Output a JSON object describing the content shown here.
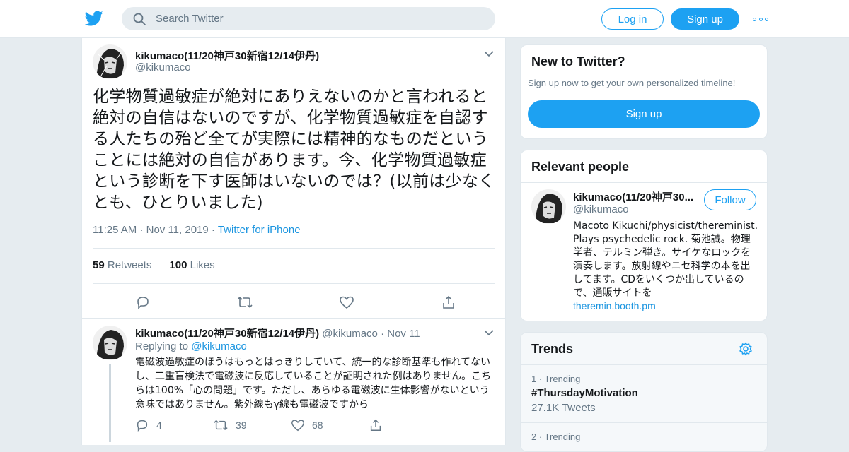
{
  "topbar": {
    "search_placeholder": "Search Twitter",
    "login_label": "Log in",
    "signup_label": "Sign up"
  },
  "tweet": {
    "display_name": "kikumaco(11/20神戸30新宿12/14伊丹)",
    "handle": "@kikumaco",
    "text": "化学物質過敏症が絶対にありえないのかと言われると絶対の自信はないのですが、化学物質過敏症を自認する人たちの殆ど全てが実際には精神的なものだということには絶対の自信があります。今、化学物質過敏症という診断を下す医師はいないのでは？(以前は少なくとも、ひとりいました)",
    "time": "11:25 AM",
    "date": "Nov 11, 2019",
    "source": "Twitter for iPhone",
    "retweets_count": "59",
    "retweets_label": "Retweets",
    "likes_count": "100",
    "likes_label": "Likes"
  },
  "reply": {
    "display_name": "kikumaco(11/20神戸30新宿12/14伊丹)",
    "handle": "@kikumaco",
    "date": "Nov 11",
    "replying_label": "Replying to",
    "replying_to": "@kikumaco",
    "text": "電磁波過敏症のほうはもっとはっきりしていて、統一的な診断基準も作れてないし、二重盲検法で電磁波に反応していることが証明された例はありません。こちらは100%「心の問題」です。ただし、あらゆる電磁波に生体影響がないという意味ではありません。紫外線もγ線も電磁波ですから",
    "replies": "4",
    "retweets": "39",
    "likes": "68"
  },
  "new_to_twitter": {
    "title": "New to Twitter?",
    "subtitle": "Sign up now to get your own personalized timeline!",
    "button": "Sign up"
  },
  "relevant_people": {
    "title": "Relevant people",
    "name": "kikumaco(11/20神戸30...",
    "handle": "@kikumaco",
    "follow_label": "Follow",
    "bio": "Macoto Kikuchi/physicist/thereminist. Plays psychedelic rock. 菊池誠。物理学者、テルミン弾き。サイケなロックを演奏します。放射線やニセ科学の本を出してます。CDをいくつか出しているので、通販サイトを",
    "link": "theremin.booth.pm"
  },
  "trends": {
    "title": "Trends",
    "items": [
      {
        "rank": "1 · Trending",
        "tag": "#ThursdayMotivation",
        "count": "27.1K Tweets"
      },
      {
        "rank": "2 · Trending"
      }
    ]
  },
  "colors": {
    "accent": "#1da1f2",
    "link": "#1b95e0",
    "background": "#e6ecf0"
  }
}
